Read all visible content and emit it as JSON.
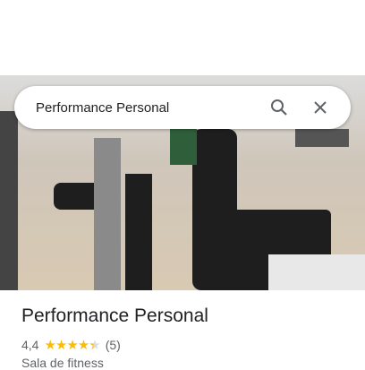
{
  "search": {
    "query": "Performance Personal",
    "search_icon": "search-icon",
    "close_icon": "close-icon"
  },
  "place": {
    "name": "Performance Personal",
    "rating": "4,4",
    "rating_value": 4.4,
    "stars": "★★★★★",
    "reviews": "(5)",
    "category": "Sala de fitness"
  },
  "colors": {
    "star": "#fbbc04"
  }
}
